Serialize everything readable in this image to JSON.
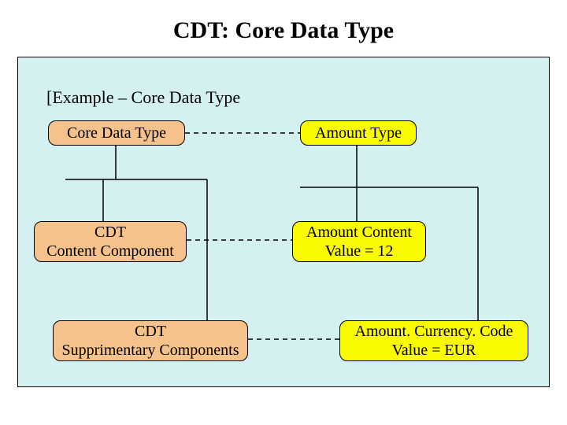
{
  "title": "CDT: Core Data Type",
  "subtitle": "[Example – Core Data Type",
  "nodes": {
    "coreDataType": "Core Data Type",
    "amountType": "Amount Type",
    "cdtContent_l1": "CDT",
    "cdtContent_l2": "Content Component",
    "amountContent_l1": "Amount Content",
    "amountContent_l2": "Value = 12",
    "cdtSupp_l1": "CDT",
    "cdtSupp_l2": "Supprimentary Components",
    "amountCurr_l1": "Amount. Currency. Code",
    "amountCurr_l2": "Value = EUR"
  }
}
